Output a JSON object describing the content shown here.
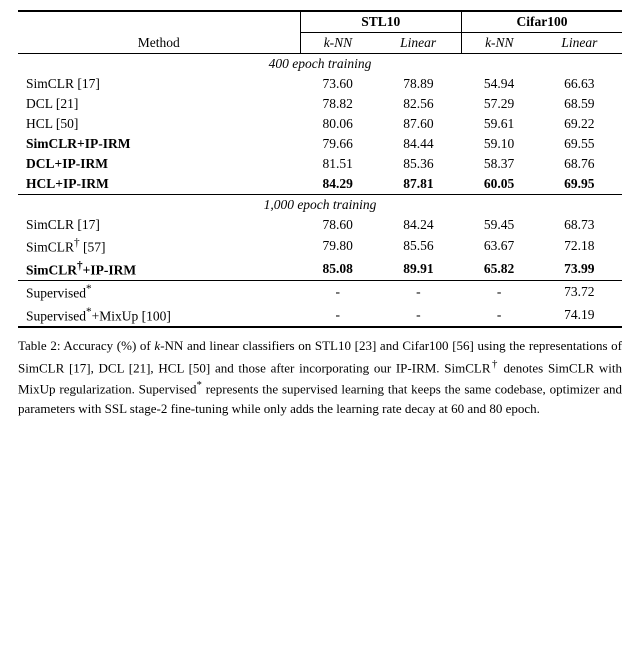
{
  "table": {
    "title": "Table 2: Accuracy (%) of k-NN and linear classifiers on STL10 [23] and Cifar100 [56] using the representations of SimCLR [17], DCL [21], HCL [50] and those after incorporating our IP-IRM. SimCLR† denotes SimCLR with MixUp regularization. Supervised* represents the supervised learning that keeps the same codebase, optimizer and parameters with SSL stage-2 fine-tuning while only adds the learning rate decay at 60 and 80 epoch.",
    "columns": {
      "method": "Method",
      "stl10": "STL10",
      "cifar100": "Cifar100",
      "knn": "k-NN",
      "linear": "Linear"
    },
    "section1_header": "400 epoch training",
    "section2_header": "1,000 epoch training",
    "rows_400": [
      {
        "method": "SimCLR [17]",
        "knn_stl": "73.60",
        "lin_stl": "78.89",
        "knn_cif": "54.94",
        "lin_cif": "66.63",
        "bold": false
      },
      {
        "method": "DCL [21]",
        "knn_stl": "78.82",
        "lin_stl": "82.56",
        "knn_cif": "57.29",
        "lin_cif": "68.59",
        "bold": false
      },
      {
        "method": "HCL [50]",
        "knn_stl": "80.06",
        "lin_stl": "87.60",
        "knn_cif": "59.61",
        "lin_cif": "69.22",
        "bold": false
      },
      {
        "method": "SimCLR+IP-IRM",
        "knn_stl": "79.66",
        "lin_stl": "84.44",
        "knn_cif": "59.10",
        "lin_cif": "69.55",
        "bold": true
      },
      {
        "method": "DCL+IP-IRM",
        "knn_stl": "81.51",
        "lin_stl": "85.36",
        "knn_cif": "58.37",
        "lin_cif": "68.76",
        "bold": true
      },
      {
        "method": "HCL+IP-IRM",
        "knn_stl": "84.29",
        "lin_stl": "87.81",
        "knn_cif": "60.05",
        "lin_cif": "69.95",
        "bold": true,
        "bold_vals": true
      }
    ],
    "rows_1000": [
      {
        "method": "SimCLR [17]",
        "knn_stl": "78.60",
        "lin_stl": "84.24",
        "knn_cif": "59.45",
        "lin_cif": "68.73",
        "bold": false
      },
      {
        "method": "SimCLR† [57]",
        "knn_stl": "79.80",
        "lin_stl": "85.56",
        "knn_cif": "63.67",
        "lin_cif": "72.18",
        "bold": false,
        "dagger": true
      },
      {
        "method": "SimCLR†+IP-IRM",
        "knn_stl": "85.08",
        "lin_stl": "89.91",
        "knn_cif": "65.82",
        "lin_cif": "73.99",
        "bold": true,
        "bold_vals": true,
        "dagger": true
      }
    ],
    "rows_supervised": [
      {
        "method": "Supervised*",
        "knn_stl": "-",
        "lin_stl": "-",
        "knn_cif": "-",
        "lin_cif": "73.72",
        "star": true
      },
      {
        "method": "Supervised*+MixUp [100]",
        "knn_stl": "-",
        "lin_stl": "-",
        "knn_cif": "-",
        "lin_cif": "74.19",
        "star": true
      }
    ]
  }
}
